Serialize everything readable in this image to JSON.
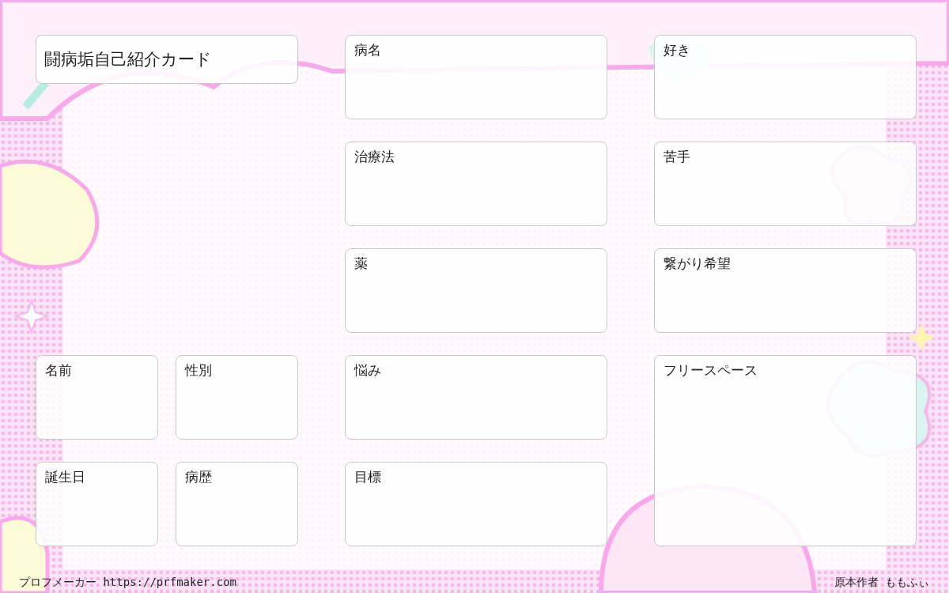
{
  "title": "闘病垢自己紹介カード",
  "left_fields": [
    {
      "label": "名前"
    },
    {
      "label": "性別"
    },
    {
      "label": "誕生日"
    },
    {
      "label": "病歴"
    }
  ],
  "middle_fields": [
    {
      "label": "病名"
    },
    {
      "label": "治療法"
    },
    {
      "label": "薬"
    },
    {
      "label": "悩み"
    },
    {
      "label": "目標"
    }
  ],
  "right_fields": [
    {
      "label": "好き"
    },
    {
      "label": "苦手"
    },
    {
      "label": "繋がり希望"
    },
    {
      "label": "フリースペース"
    }
  ],
  "footer": {
    "site": "プロフメーカー https://prfmaker.com",
    "author": "原本作者 ももふぃ"
  }
}
